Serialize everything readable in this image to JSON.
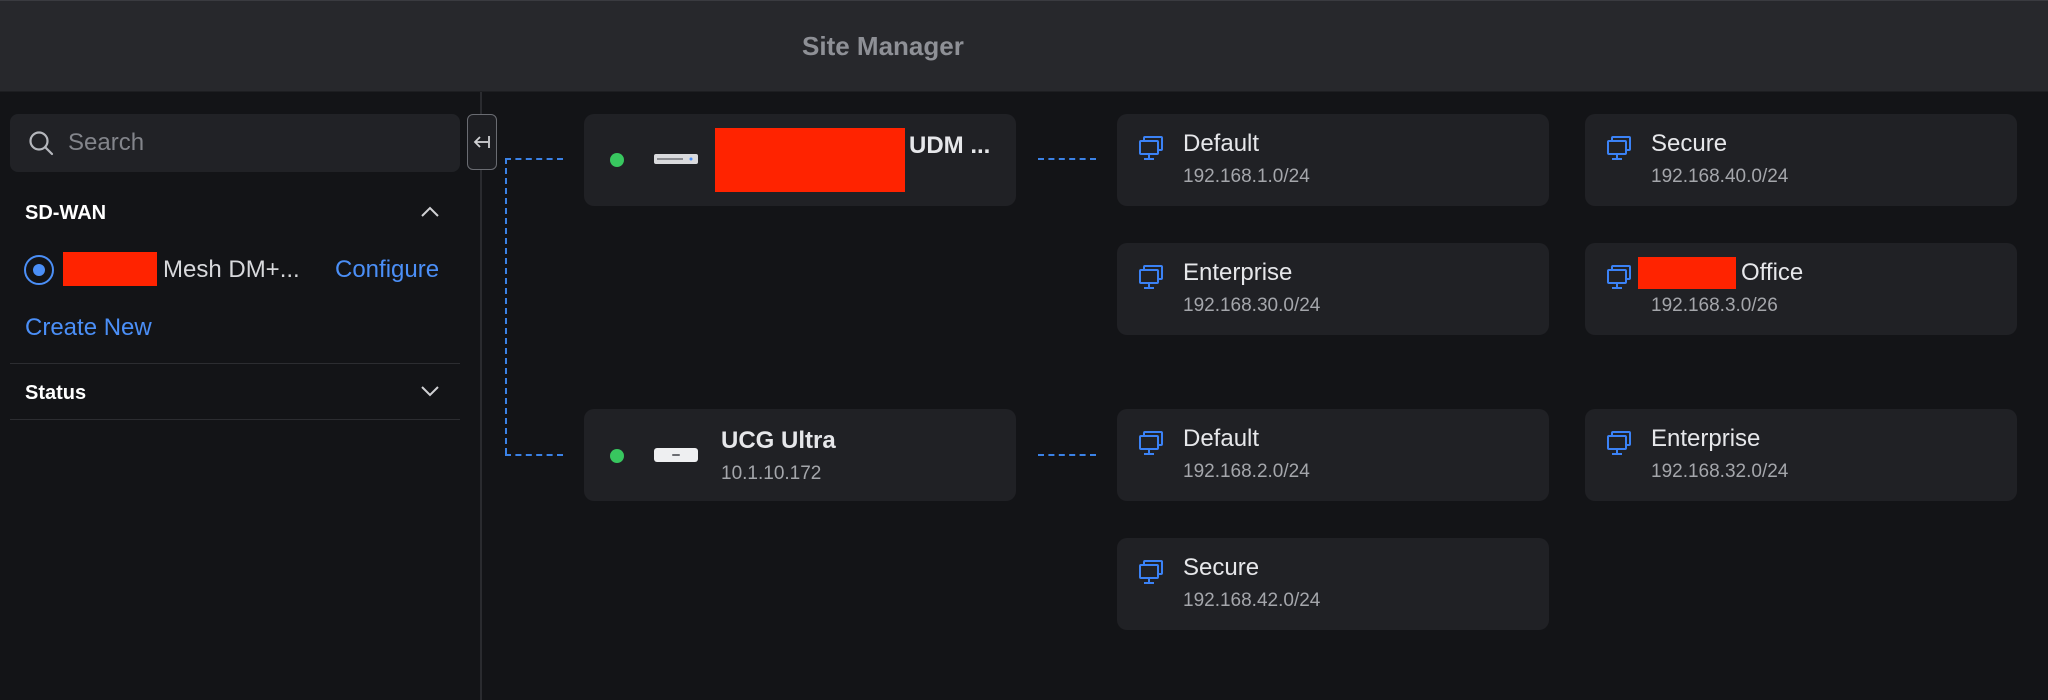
{
  "app": {
    "title": "Site Manager"
  },
  "search": {
    "placeholder": "Search"
  },
  "sidebar": {
    "sdwan_header": "SD-WAN",
    "mesh_item": {
      "name": "Mesh DM+...",
      "configure_label": "Configure"
    },
    "create_new_label": "Create New",
    "status_header": "Status"
  },
  "colors": {
    "accent": "#4b8ff7",
    "online": "#38c75f",
    "redaction": "#ff2300",
    "card_bg": "#202125",
    "background": "#131417"
  },
  "icons": [
    "search-icon",
    "collapse-panel-icon",
    "chevron-up-icon",
    "chevron-down-icon",
    "monitor-icon",
    "router-icon"
  ],
  "gateways": [
    {
      "name": "UDM ...",
      "status": "online",
      "networks": [
        {
          "name": "Default",
          "subnet": "192.168.1.0/24"
        },
        {
          "name": "Secure",
          "subnet": "192.168.40.0/24"
        },
        {
          "name": "Enterprise",
          "subnet": "192.168.30.0/24"
        },
        {
          "name": "Office",
          "subnet": "192.168.3.0/26"
        }
      ]
    },
    {
      "name": "UCG Ultra",
      "ip": "10.1.10.172",
      "status": "online",
      "networks": [
        {
          "name": "Default",
          "subnet": "192.168.2.0/24"
        },
        {
          "name": "Enterprise",
          "subnet": "192.168.32.0/24"
        },
        {
          "name": "Secure",
          "subnet": "192.168.42.0/24"
        }
      ]
    }
  ]
}
